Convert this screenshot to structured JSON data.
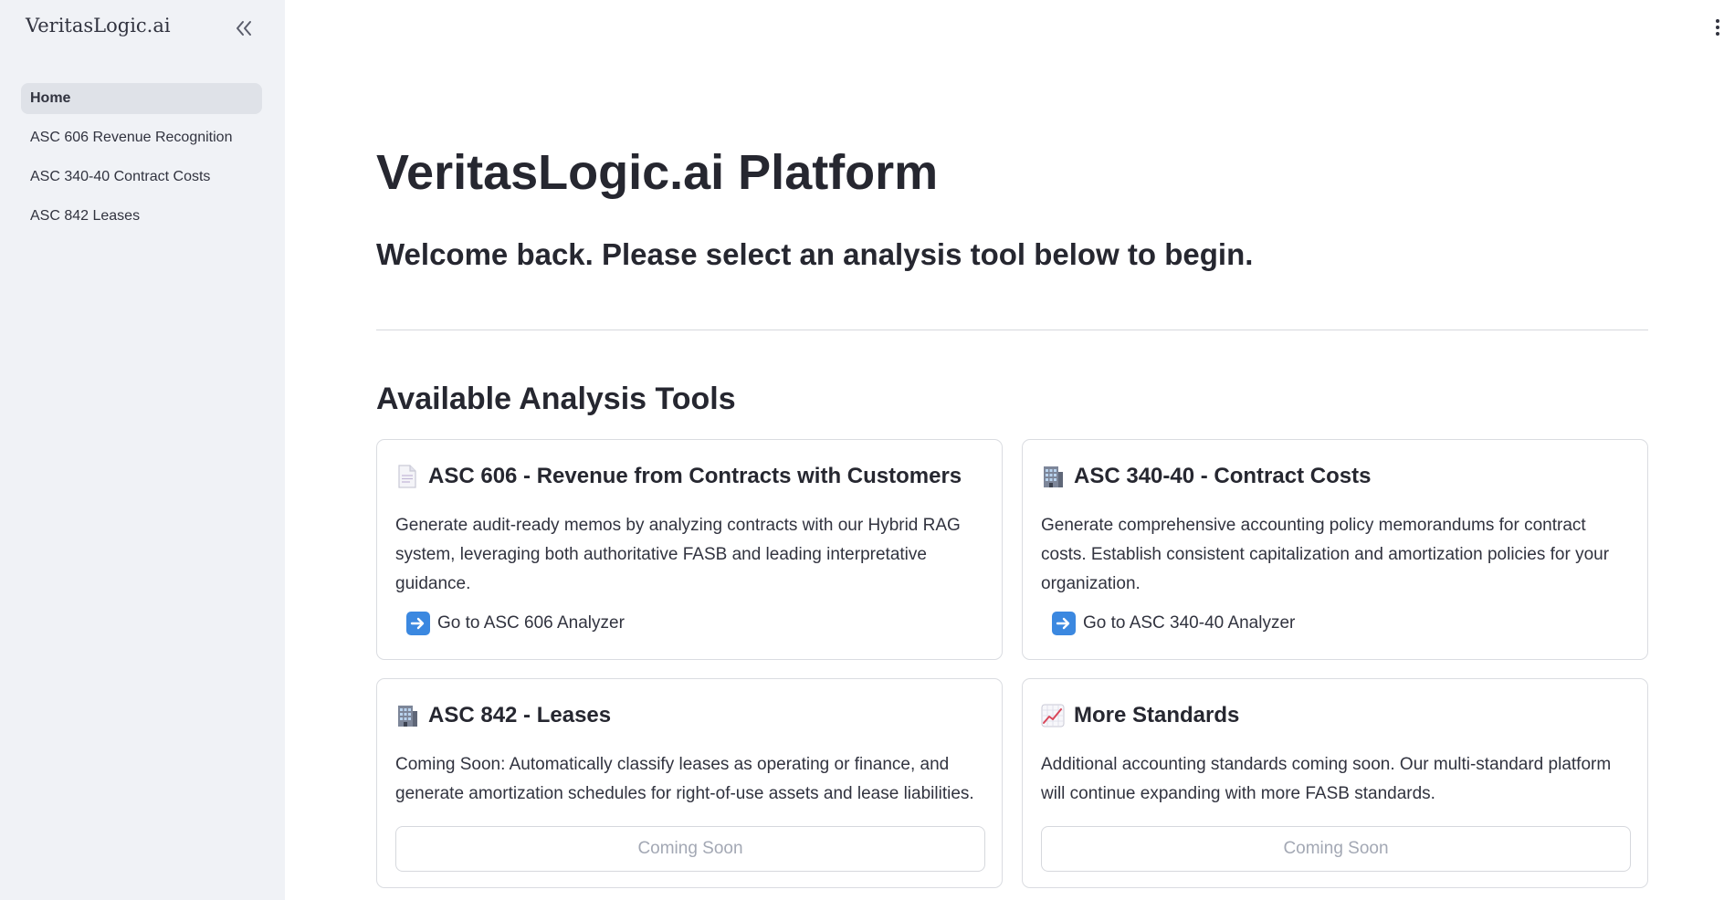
{
  "sidebar": {
    "brand": "VeritasLogic.ai",
    "items": [
      {
        "label": "Home",
        "active": true
      },
      {
        "label": "ASC 606 Revenue Recognition",
        "active": false
      },
      {
        "label": "ASC 340-40 Contract Costs",
        "active": false
      },
      {
        "label": "ASC 842 Leases",
        "active": false
      }
    ]
  },
  "header": {
    "title": "VeritasLogic.ai Platform",
    "subtitle": "Welcome back. Please select an analysis tool below to begin."
  },
  "tools_section": {
    "title": "Available Analysis Tools",
    "cards": [
      {
        "icon": "document-icon",
        "title": "ASC 606 - Revenue from Contracts with Customers",
        "description": "Generate audit-ready memos by analyzing contracts with our Hybrid RAG system, leveraging both authoritative FASB and leading interpretative guidance.",
        "link_label": "Go to ASC 606 Analyzer"
      },
      {
        "icon": "office-building-icon",
        "title": "ASC 340-40 - Contract Costs",
        "description": "Generate comprehensive accounting policy memorandums for contract costs. Establish consistent capitalization and amortization policies for your organization.",
        "link_label": "Go to ASC 340-40 Analyzer"
      },
      {
        "icon": "office-building-icon",
        "title": "ASC 842 - Leases",
        "description": "Coming Soon: Automatically classify leases as operating or finance, and generate amortization schedules for right-of-use assets and lease liabilities.",
        "button_label": "Coming Soon"
      },
      {
        "icon": "chart-increasing-icon",
        "title": "More Standards",
        "description": "Additional accounting standards coming soon. Our multi-standard platform will continue expanding with more FASB standards.",
        "button_label": "Coming Soon"
      }
    ]
  },
  "colors": {
    "sidebar_bg": "#f0f2f6",
    "active_item_bg": "#dfe2e8",
    "arrow_icon": "#3b88e0",
    "disabled_text": "#a3a8b4"
  }
}
